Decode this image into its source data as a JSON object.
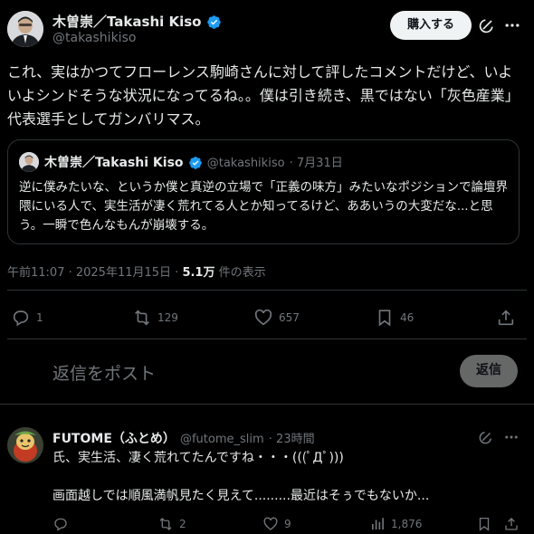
{
  "tweet": {
    "author_name": "木曽崇／Takashi Kiso",
    "author_handle": "@takashikiso",
    "buy_label": "購入する",
    "text": "これ、実はかつてフローレンス駒崎さんに対して評したコメントだけど、いよいよシンドそうな状況になってるね。。僕は引き続き、黒ではない「灰色産業」代表選手としてガンバリマス。",
    "timestamp": "午前11:07 · 2025年11月15日 · ",
    "views_count": "5.1万",
    "views_label": " 件の表示"
  },
  "quote": {
    "author_name": "木曽崇／Takashi Kiso",
    "author_handle": "@takashikiso",
    "date": "· 7月31日",
    "text": "逆に僕みたいな、というか僕と真逆の立場で「正義の味方」みたいなポジションで論壇界隈にいる人で、実生活が凄く荒れてる人とか知ってるけど、ああいうの大変だな...と思う。一瞬で色んなもんが崩壊する。"
  },
  "actions": {
    "replies": "1",
    "reposts": "129",
    "likes": "657",
    "bookmarks": "46"
  },
  "composer": {
    "placeholder": "返信をポスト",
    "reply_button": "返信"
  },
  "reply": {
    "author_name": "FUTOME（ふとめ）",
    "author_handle": "@futome_slim",
    "time": "· 23時間",
    "line1": "氏、実生活、凄く荒れてたんですね・・・(((ﾟДﾟ)))",
    "line2": "画面越しでは順風満帆見たく見えて.........最近はそぅでもないか...",
    "replies": "",
    "reposts": "2",
    "likes": "9",
    "views": "1,876"
  },
  "colors": {
    "background": "#000000",
    "text": "#e7e9ea",
    "secondary": "#71767b",
    "verified": "#1d9bf0",
    "border": "#2f3336"
  }
}
